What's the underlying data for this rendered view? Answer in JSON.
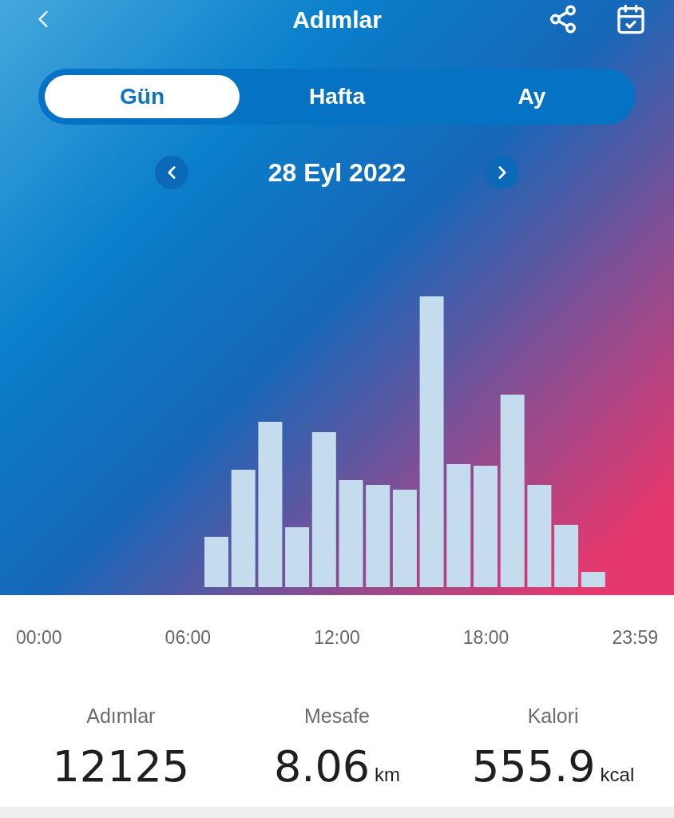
{
  "header": {
    "title": "Adımlar"
  },
  "tabs": [
    {
      "label": "Gün",
      "selected": true
    },
    {
      "label": "Hafta",
      "selected": false
    },
    {
      "label": "Ay",
      "selected": false
    }
  ],
  "date": "28 Eyl 2022",
  "axis_labels": [
    "00:00",
    "06:00",
    "12:00",
    "18:00",
    "23:59"
  ],
  "stats": [
    {
      "label": "Adımlar",
      "value": "12125"
    },
    {
      "label": "Mesafe",
      "value": "8.06",
      "unit": "km"
    },
    {
      "label": "Kalori",
      "value": "555.9",
      "unit": "kcal"
    }
  ]
}
